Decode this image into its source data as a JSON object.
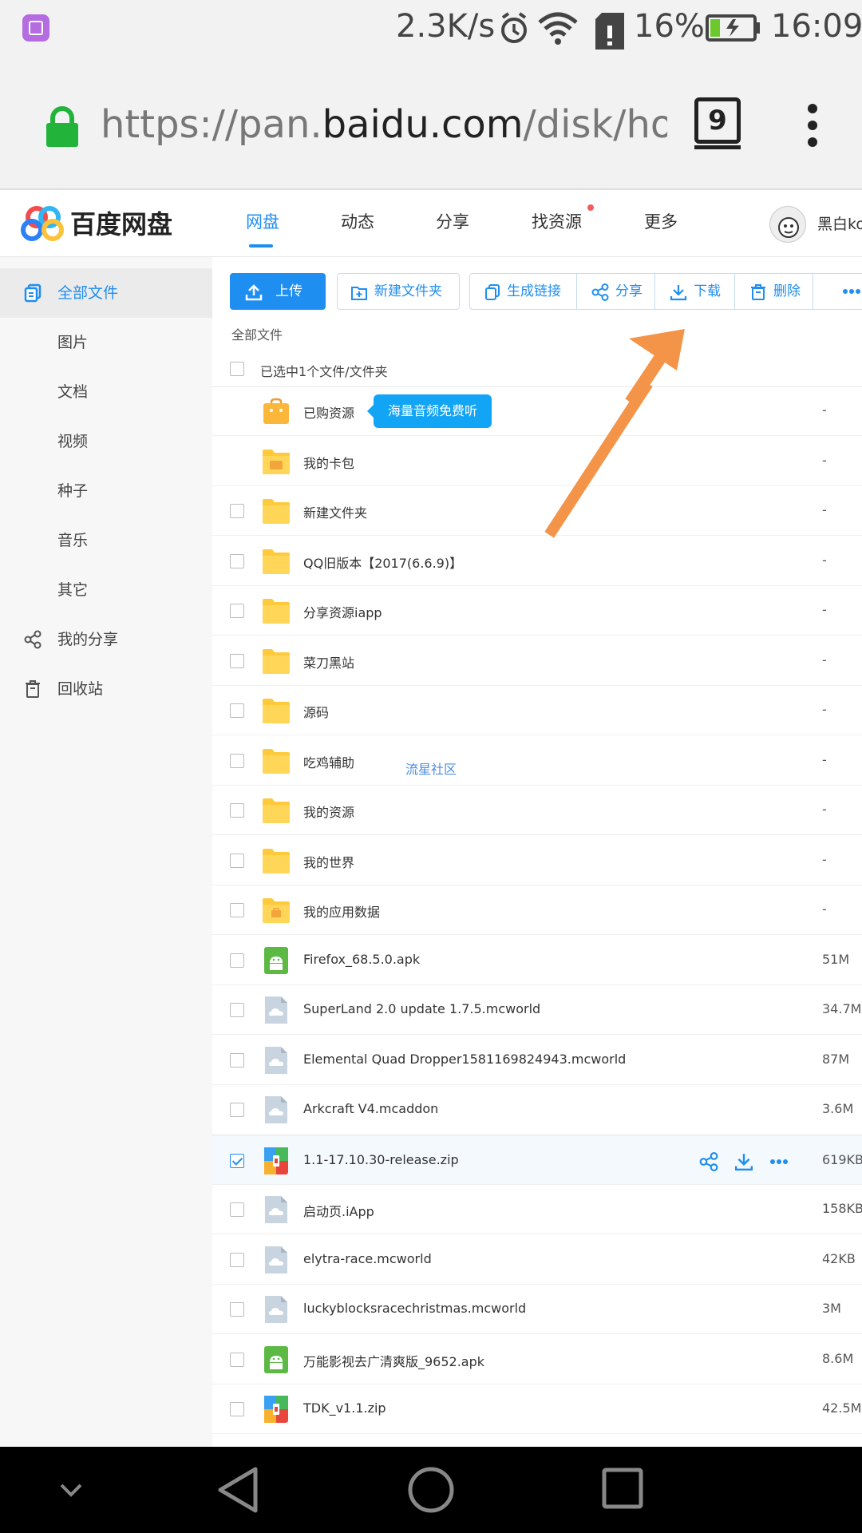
{
  "status_bar": {
    "net_speed": "2.3K/s",
    "battery": "16%",
    "time": "16:09"
  },
  "browser": {
    "url_prefix": "https://pan.",
    "url_domain": "baidu.com",
    "url_suffix": "/disk/home",
    "tab_count": "9"
  },
  "header": {
    "logo_text": "百度网盘",
    "nav": [
      "网盘",
      "动态",
      "分享",
      "找资源",
      "更多"
    ],
    "user_name": "黑白ko"
  },
  "sidebar": {
    "items": [
      "全部文件",
      "图片",
      "文档",
      "视频",
      "种子",
      "音乐",
      "其它",
      "我的分享",
      "回收站"
    ]
  },
  "toolbar": {
    "upload": "上传",
    "new_folder": "新建文件夹",
    "gen_link": "生成链接",
    "share": "分享",
    "download": "下载",
    "delete": "删除"
  },
  "main": {
    "breadcrumb": "全部文件",
    "selection_text": "已选中1个文件/文件夹",
    "tooltip": "海量音频免费听",
    "watermark": "流星社区"
  },
  "files": [
    {
      "name": "已购资源",
      "size": "-",
      "type": "bag"
    },
    {
      "name": "我的卡包",
      "size": "-",
      "type": "card"
    },
    {
      "name": "新建文件夹",
      "size": "-",
      "type": "folder"
    },
    {
      "name": "QQ旧版本【2017(6.6.9)】",
      "size": "-",
      "type": "folder"
    },
    {
      "name": "分享资源iapp",
      "size": "-",
      "type": "folder"
    },
    {
      "name": "菜刀黑站",
      "size": "-",
      "type": "folder"
    },
    {
      "name": "源码",
      "size": "-",
      "type": "folder"
    },
    {
      "name": "吃鸡辅助",
      "size": "-",
      "type": "folder"
    },
    {
      "name": "我的资源",
      "size": "-",
      "type": "folder"
    },
    {
      "name": "我的世界",
      "size": "-",
      "type": "folder"
    },
    {
      "name": "我的应用数据",
      "size": "-",
      "type": "appfolder"
    },
    {
      "name": "Firefox_68.5.0.apk",
      "size": "51M",
      "type": "apk"
    },
    {
      "name": "SuperLand 2.0 update 1.7.5.mcworld",
      "size": "34.7M",
      "type": "unknown"
    },
    {
      "name": "Elemental Quad Dropper1581169824943.mcworld",
      "size": "87M",
      "type": "unknown"
    },
    {
      "name": "Arkcraft V4.mcaddon",
      "size": "3.6M",
      "type": "unknown"
    },
    {
      "name": "1.1-17.10.30-release.zip",
      "size": "619KB",
      "type": "zip"
    },
    {
      "name": "启动页.iApp",
      "size": "158KB",
      "type": "unknown"
    },
    {
      "name": "elytra-race.mcworld",
      "size": "42KB",
      "type": "unknown"
    },
    {
      "name": "luckyblocksracechristmas.mcworld",
      "size": "3M",
      "type": "unknown"
    },
    {
      "name": "万能影视去广清爽版_9652.apk",
      "size": "8.6M",
      "type": "apk"
    },
    {
      "name": "TDK_v1.1.zip",
      "size": "42.5M",
      "type": "zip"
    }
  ],
  "colors": {
    "accent": "#1f8ef1",
    "folder": "#ffc93c",
    "annotation_arrow": "#f39449"
  }
}
